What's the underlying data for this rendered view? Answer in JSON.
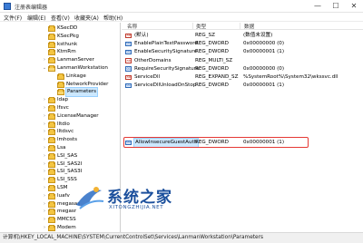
{
  "window": {
    "title": "注册表编辑器",
    "controls": {
      "minimize": "—",
      "maximize": "☐",
      "close": "✕"
    }
  },
  "menu": [
    "文件(F)",
    "编辑(E)",
    "查看(V)",
    "收藏夹(A)",
    "帮助(H)"
  ],
  "tree": {
    "items": [
      {
        "label": "KSecDD",
        "expander": "",
        "selected": false
      },
      {
        "label": "KSecPkg",
        "expander": "",
        "selected": false
      },
      {
        "label": "ksthunk",
        "expander": "",
        "selected": false
      },
      {
        "label": "KtmRm",
        "expander": "",
        "selected": false
      },
      {
        "label": "LanmanServer",
        "expander": "›",
        "selected": false
      },
      {
        "label": "LanmanWorkstation",
        "expander": "⌄",
        "selected": false
      },
      {
        "label": "Linkage",
        "expander": "",
        "selected": false
      },
      {
        "label": "NetworkProvider",
        "expander": "",
        "selected": false
      },
      {
        "label": "Parameters",
        "expander": "",
        "selected": true
      },
      {
        "label": "ldap",
        "expander": "›",
        "selected": false
      },
      {
        "label": "lfsvc",
        "expander": "›",
        "selected": false
      },
      {
        "label": "LicenseManager",
        "expander": "›",
        "selected": false
      },
      {
        "label": "lltdio",
        "expander": "›",
        "selected": false
      },
      {
        "label": "lltdsvc",
        "expander": "›",
        "selected": false
      },
      {
        "label": "lmhosts",
        "expander": "›",
        "selected": false
      },
      {
        "label": "Lsa",
        "expander": "›",
        "selected": false
      },
      {
        "label": "LSI_SAS",
        "expander": "›",
        "selected": false
      },
      {
        "label": "LSI_SAS2I",
        "expander": "›",
        "selected": false
      },
      {
        "label": "LSI_SAS3I",
        "expander": "›",
        "selected": false
      },
      {
        "label": "LSI_SSS",
        "expander": "›",
        "selected": false
      },
      {
        "label": "LSM",
        "expander": "›",
        "selected": false
      },
      {
        "label": "luafv",
        "expander": "›",
        "selected": false
      },
      {
        "label": "megasas",
        "expander": "›",
        "selected": false
      },
      {
        "label": "megasr",
        "expander": "›",
        "selected": false
      },
      {
        "label": "MMCSS",
        "expander": "›",
        "selected": false
      },
      {
        "label": "Modem",
        "expander": "›",
        "selected": false
      }
    ]
  },
  "values": {
    "headers": {
      "name": "名称",
      "type": "类型",
      "data": "数据"
    },
    "rows": [
      {
        "icon": "sz",
        "name": "(默认)",
        "type": "REG_SZ",
        "data": "(数值未设置)",
        "selected": false
      },
      {
        "icon": "dw",
        "name": "EnablePlainTextPassword",
        "type": "REG_DWORD",
        "data": "0x00000000 (0)",
        "selected": false
      },
      {
        "icon": "dw",
        "name": "EnableSecuritySignature",
        "type": "REG_DWORD",
        "data": "0x00000001 (1)",
        "selected": false
      },
      {
        "icon": "sz",
        "name": "OtherDomains",
        "type": "REG_MULTI_SZ",
        "data": "",
        "selected": false
      },
      {
        "icon": "dw",
        "name": "RequireSecuritySignature",
        "type": "REG_DWORD",
        "data": "0x00000000 (0)",
        "selected": false
      },
      {
        "icon": "sz",
        "name": "ServiceDll",
        "type": "REG_EXPAND_SZ",
        "data": "%SystemRoot%\\System32\\wkssvc.dll",
        "selected": false
      },
      {
        "icon": "dw",
        "name": "ServiceDllUnloadOnStop",
        "type": "REG_DWORD",
        "data": "0x00000001 (1)",
        "selected": false
      },
      {
        "icon": "dw",
        "name": "AllowInsecureGuestAuth",
        "type": "REG_DWORD",
        "data": "0x00000001 (1)",
        "selected": true
      }
    ]
  },
  "status": {
    "path": "计算机\\HKEY_LOCAL_MACHINE\\SYSTEM\\CurrentControlSet\\Services\\LanmanWorkstation\\Parameters"
  },
  "watermark": {
    "title": "系统之家",
    "url": "XITONGZHIJIA.NET"
  },
  "colors": {
    "highlight_border": "#e53935",
    "selection": "#cce8ff",
    "folder": "#f4c542",
    "watermark": "#1b4f9c"
  }
}
